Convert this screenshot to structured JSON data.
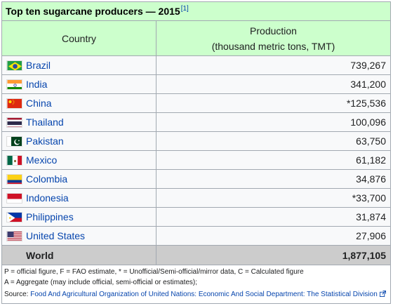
{
  "table": {
    "title": "Top ten sugarcane producers — 2015",
    "title_ref": "[1]",
    "header_country": "Country",
    "header_production_line1": "Production",
    "header_production_line2": "(thousand metric tons, TMT)",
    "rows": [
      {
        "country": "Brazil",
        "value": "739,267",
        "flag": "brazil-flag-icon"
      },
      {
        "country": "India",
        "value": "341,200",
        "flag": "india-flag-icon"
      },
      {
        "country": "China",
        "value": "*125,536",
        "flag": "china-flag-icon"
      },
      {
        "country": "Thailand",
        "value": "100,096",
        "flag": "thailand-flag-icon"
      },
      {
        "country": "Pakistan",
        "value": "63,750",
        "flag": "pakistan-flag-icon"
      },
      {
        "country": "Mexico",
        "value": "61,182",
        "flag": "mexico-flag-icon"
      },
      {
        "country": "Colombia",
        "value": "34,876",
        "flag": "colombia-flag-icon"
      },
      {
        "country": "Indonesia",
        "value": "*33,700",
        "flag": "indonesia-flag-icon"
      },
      {
        "country": "Philippines",
        "value": "31,874",
        "flag": "philippines-flag-icon"
      },
      {
        "country": "United States",
        "value": "27,906",
        "flag": "usa-flag-icon"
      }
    ],
    "world_label": "World",
    "world_value": "1,877,105"
  },
  "notes": {
    "line1": "P = official figure, F = FAO estimate, * = Unofficial/Semi-official/mirror data, C = Calculated figure",
    "line2": "A = Aggregate (may include official, semi-official or estimates);",
    "source_label": "Source: ",
    "source_link": "Food And Agricultural Organization of United Nations: Economic And Social Department: The Statistical Division"
  },
  "colors": {
    "header_bg": "#ccffcc",
    "row_bg": "#f8f9fa",
    "world_bg": "#cccccc",
    "link": "#0645ad",
    "border": "#a2a9b1"
  }
}
